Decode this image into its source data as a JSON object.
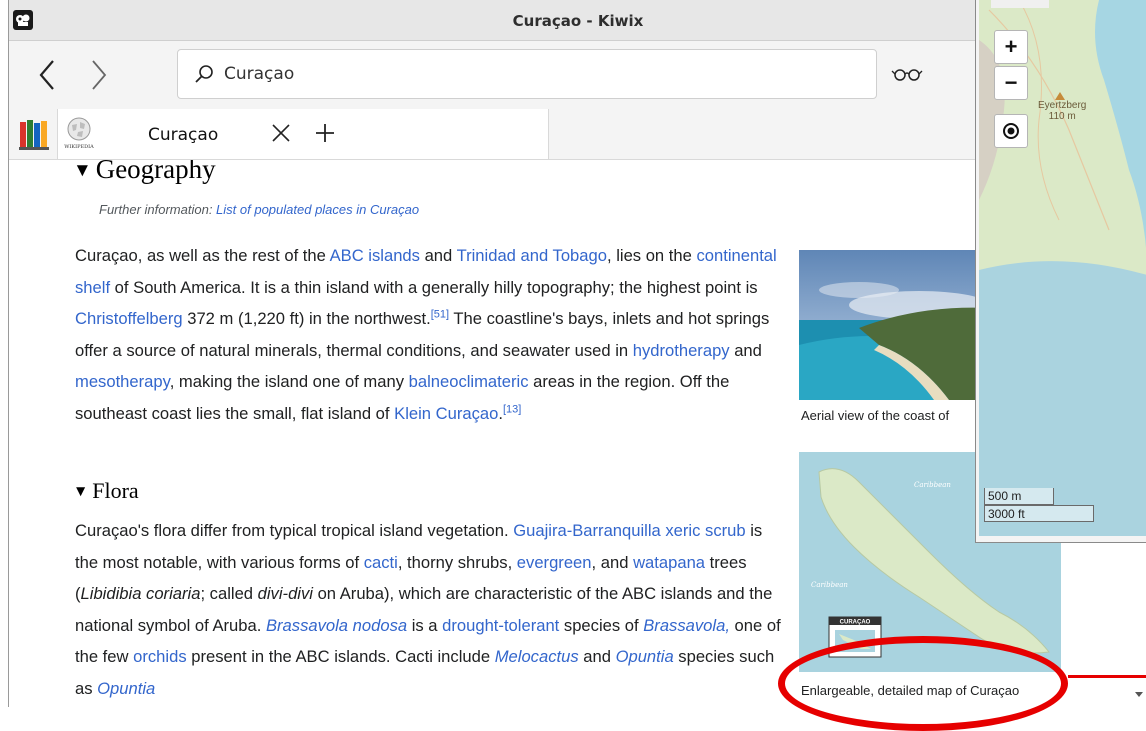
{
  "window": {
    "title": "Curaçao - Kiwix"
  },
  "toolbar": {
    "search_value": "Curaçao"
  },
  "tabs": [
    {
      "label": "Curaçao"
    }
  ],
  "article": {
    "geography_heading": "Geography",
    "hatnote_prefix": "Further information: ",
    "hatnote_link": "List of populated places in Curaçao",
    "para1": {
      "t0": "Curaçao, as well as the rest of the ",
      "l_abc": "ABC islands",
      "t1": " and ",
      "l_trinidad": "Trinidad and Tobago",
      "t2": ", lies on the ",
      "l_shelf": "continental shelf",
      "t3": " of South America. It is a thin island with a generally hilly topography; the highest point is ",
      "l_christoffel": "Christoffelberg",
      "t4": " 372 m (1,220 ft) in the northwest.",
      "ref1": "[51]",
      "t5": " The coastline's bays, inlets and hot springs offer a source of natural minerals, thermal conditions, and seawater used in ",
      "l_hydro": "hydrotherapy",
      "t6": " and ",
      "l_meso": "mesotherapy",
      "t7": ", making the island one of many ",
      "l_balneo": "balneoclimateric",
      "t8": " areas in the region. Off the southeast coast lies the small, flat island of ",
      "l_klein": "Klein Curaçao",
      "t9": ".",
      "ref2": "[13]"
    },
    "flora_heading": "Flora",
    "para2": {
      "t0": "Curaçao's flora differ from typical tropical island vegetation. ",
      "l_guajira": "Guajira-Barranquilla xeric scrub",
      "t1": " is the most notable, with various forms of ",
      "l_cacti": "cacti",
      "t2": ", thorny shrubs, ",
      "l_evergreen": "evergreen",
      "t3": ", and ",
      "l_watapana": "watapana",
      "t4": " trees (",
      "i_lib": "Libidibia coriaria",
      "t5": "; called ",
      "i_divi": "divi-divi",
      "t6": " on Aruba), which are characteristic of the ABC islands and the national symbol of Aruba. ",
      "l_brassavola": "Brassavola nodosa",
      "t7": " is a ",
      "l_drought": "drought-tolerant",
      "t8": " species of ",
      "l_brass2": "Brassavola,",
      "t9": " one of the few ",
      "l_orchids": "orchids",
      "t10": " present in the ABC islands. Cacti include ",
      "l_melo": "Melocactus",
      "t11": " and ",
      "l_opuntia": "Opuntia",
      "t12": " species such as ",
      "l_opuntia2": "Opuntia"
    },
    "figure1_caption": "Aerial view of the coast of",
    "figure2_caption": "Enlargeable, detailed map of Curaçao",
    "map_thumb": {
      "sea_label_1": "Caribbean",
      "sea_label_2": "Caribbean",
      "inset_label": "CURAÇAO"
    }
  },
  "map_popup": {
    "zoom_in": "+",
    "zoom_out": "−",
    "place_name": "Eyertzberg",
    "place_elev": "110 m",
    "scale_metric": "500 m",
    "scale_imperial": "3000 ft"
  },
  "colors": {
    "link": "#3366cc",
    "highlight": "#e60000",
    "sea": "#a9d3df",
    "land": "#dbe9c7"
  },
  "icons": [
    "kiwix-logo-icon",
    "back-icon",
    "forward-icon",
    "search-icon",
    "reading-glasses-icon",
    "library-icon",
    "wikipedia-logo-icon",
    "close-icon",
    "plus-icon",
    "locate-icon",
    "scroll-down-icon"
  ]
}
